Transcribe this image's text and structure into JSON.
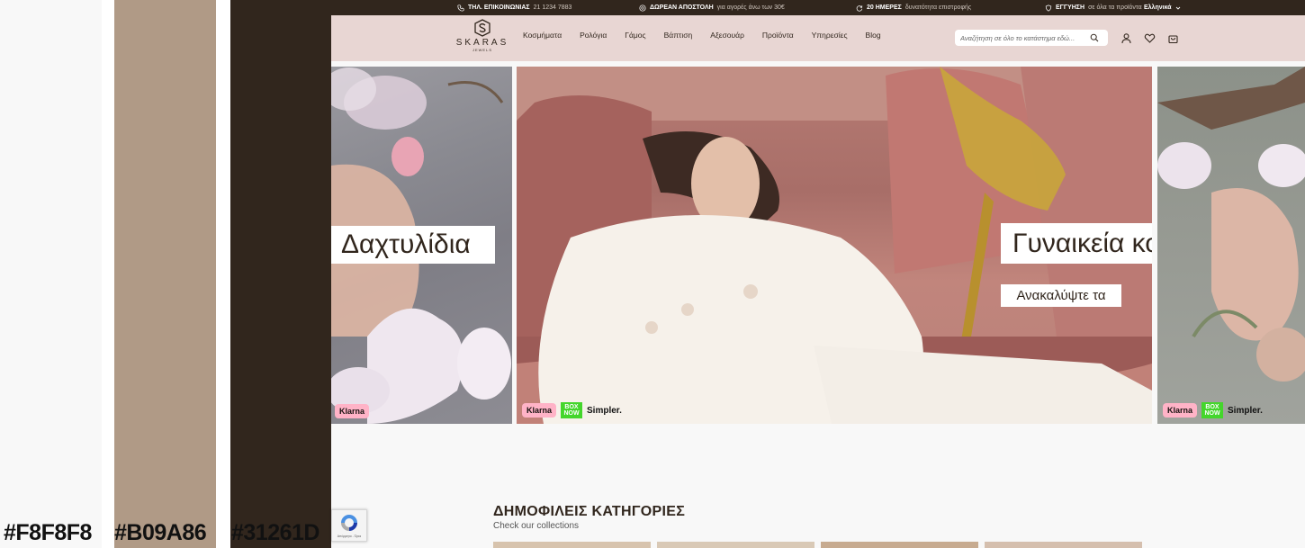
{
  "palette": {
    "swatches": [
      {
        "hex": "#F8F8F8",
        "label": "#F8F8F8"
      },
      {
        "hex": "#B09A86",
        "label": "#B09A86"
      },
      {
        "hex": "#31261D",
        "label": "#31261D"
      }
    ]
  },
  "topbar": {
    "contact_label": "ΤΗΛ. ΕΠΙΚΟΙΝΩΝΙΑΣ",
    "contact_phone": "21 1234 7883",
    "shipping_bold": "ΔΩΡΕΑΝ ΑΠΟΣΤΟΛΗ",
    "shipping_rest": "για αγορές άνω των 30€",
    "returns_bold": "20 ΗΜΕΡΕΣ",
    "returns_rest": "δυνατότητα επιστροφής",
    "warranty_bold": "ΕΓΓΥΗΣΗ",
    "warranty_rest": "σε όλα τα προϊόντα",
    "language": "Ελληνικά"
  },
  "header": {
    "logo_text": "SKARAS",
    "logo_sub": "JEWELS",
    "nav": [
      {
        "label": "Κοσμήματα"
      },
      {
        "label": "Ρολόγια"
      },
      {
        "label": "Γάμος"
      },
      {
        "label": "Βάπτιση"
      },
      {
        "label": "Αξεσουάρ"
      },
      {
        "label": "Προϊόντα"
      },
      {
        "label": "Υπηρεσίες"
      },
      {
        "label": "Blog"
      }
    ],
    "search_placeholder": "Αναζήτηση σε όλο το κατάστημα εδώ..."
  },
  "hero": {
    "left_title": "Δαχτυλίδια",
    "main_title": "Γυναικεία κοσμήματα",
    "main_cta": "Ανακαλύψτε τα",
    "badges": {
      "klarna": "Klarna",
      "boxnow_1": "BOX",
      "boxnow_2": "NOW",
      "simpler": "Simpler."
    }
  },
  "categories": {
    "title": "ΔΗΜΟΦΙΛΕΙΣ ΚΑΤΗΓΟΡΙΕΣ",
    "subtitle": "Check our collections"
  },
  "recaptcha": {
    "text": "Απόρρητο - Όροι"
  },
  "colors": {
    "dark": "#31261D",
    "header_bg": "#E8D6D3",
    "taupe": "#B09A86",
    "light": "#F8F8F8"
  }
}
